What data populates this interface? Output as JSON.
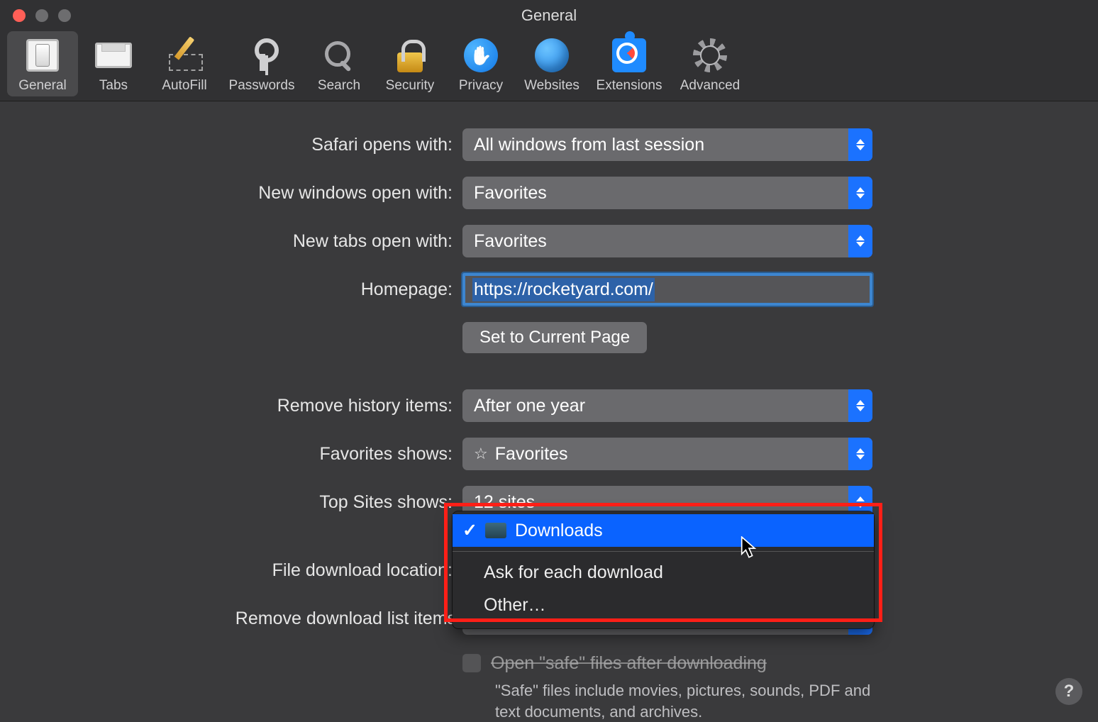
{
  "window": {
    "title": "General"
  },
  "toolbar": {
    "items": [
      {
        "id": "general",
        "label": "General",
        "selected": true
      },
      {
        "id": "tabs",
        "label": "Tabs",
        "selected": false
      },
      {
        "id": "autofill",
        "label": "AutoFill",
        "selected": false
      },
      {
        "id": "passwords",
        "label": "Passwords",
        "selected": false
      },
      {
        "id": "search",
        "label": "Search",
        "selected": false
      },
      {
        "id": "security",
        "label": "Security",
        "selected": false
      },
      {
        "id": "privacy",
        "label": "Privacy",
        "selected": false
      },
      {
        "id": "websites",
        "label": "Websites",
        "selected": false
      },
      {
        "id": "extensions",
        "label": "Extensions",
        "selected": false
      },
      {
        "id": "advanced",
        "label": "Advanced",
        "selected": false
      }
    ]
  },
  "form": {
    "safari_opens_with": {
      "label": "Safari opens with:",
      "value": "All windows from last session"
    },
    "new_windows_open_with": {
      "label": "New windows open with:",
      "value": "Favorites"
    },
    "new_tabs_open_with": {
      "label": "New tabs open with:",
      "value": "Favorites"
    },
    "homepage": {
      "label": "Homepage:",
      "value": "https://rocketyard.com/"
    },
    "set_current_button": "Set to Current Page",
    "remove_history_items": {
      "label": "Remove history items:",
      "value": "After one year"
    },
    "favorites_shows": {
      "label": "Favorites shows:",
      "value": "Favorites"
    },
    "top_sites_shows": {
      "label": "Top Sites shows:",
      "value": "12 sites"
    },
    "file_download_location": {
      "label": "File download location:",
      "value": "Downloads"
    },
    "remove_download_items": {
      "label": "Remove download list items:",
      "value": ""
    },
    "open_safe_files": {
      "label": "Open \"safe\" files after downloading",
      "note": "\"Safe\" files include movies, pictures, sounds, PDF and text documents, and archives."
    }
  },
  "download_menu": {
    "selected": "Downloads",
    "options": [
      {
        "label": "Downloads",
        "checked": true,
        "icon": "folder"
      },
      {
        "label": "Ask for each download",
        "checked": false
      },
      {
        "label": "Other…",
        "checked": false
      }
    ]
  },
  "help_label": "?"
}
